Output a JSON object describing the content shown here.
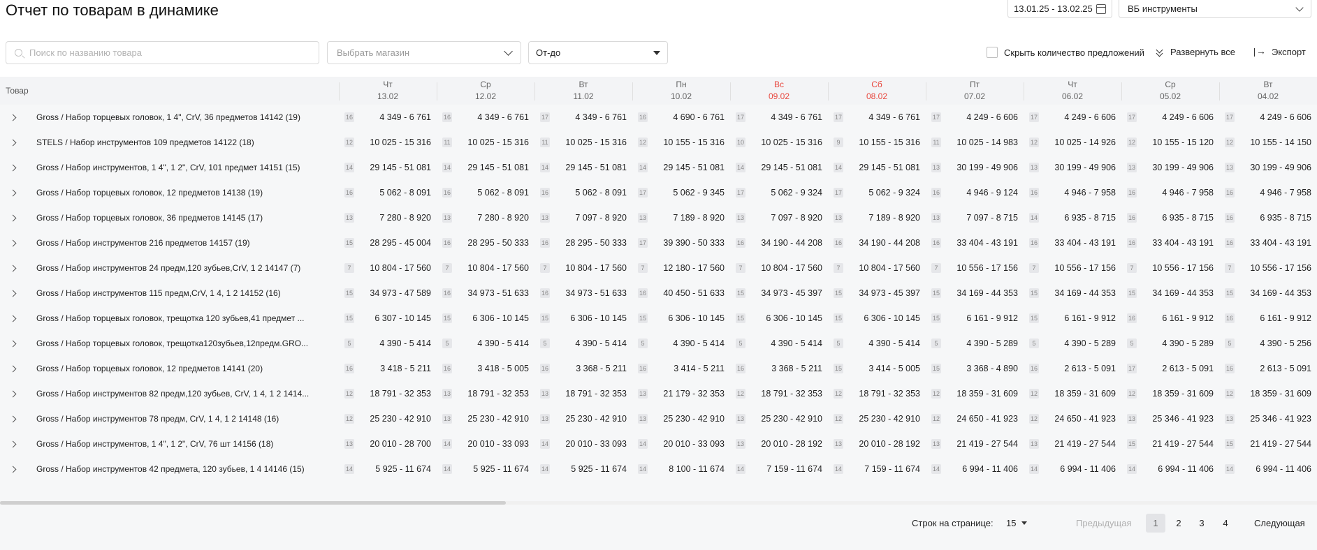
{
  "header": {
    "title": "Отчет по товарам в динамике",
    "date_range": "13.01.25 - 13.02.25",
    "shop": "ВБ инструменты"
  },
  "filters": {
    "search_placeholder": "Поиск по названию товара",
    "store_placeholder": "Выбрать магазин",
    "sort_value": "От-до",
    "hide_offers_label": "Скрыть количество предложений",
    "hide_offers_checked": false,
    "expand_all_label": "Развернуть все",
    "export_label": "Экспорт"
  },
  "table": {
    "product_header": "Товар",
    "days": [
      {
        "dow": "Чт",
        "date": "13.02",
        "weekend": false
      },
      {
        "dow": "Ср",
        "date": "12.02",
        "weekend": false
      },
      {
        "dow": "Вт",
        "date": "11.02",
        "weekend": false
      },
      {
        "dow": "Пн",
        "date": "10.02",
        "weekend": false
      },
      {
        "dow": "Вс",
        "date": "09.02",
        "weekend": true
      },
      {
        "dow": "Сб",
        "date": "08.02",
        "weekend": true
      },
      {
        "dow": "Пт",
        "date": "07.02",
        "weekend": false
      },
      {
        "dow": "Чт",
        "date": "06.02",
        "weekend": false
      },
      {
        "dow": "Ср",
        "date": "05.02",
        "weekend": false
      },
      {
        "dow": "Вт",
        "date": "04.02",
        "weekend": false
      }
    ],
    "rows": [
      {
        "name": "Gross / Набор торцевых головок, 1 4\", CrV, 36 предметов 14142 (19)",
        "cells": [
          [
            "16",
            "4 349 - 6 761"
          ],
          [
            "16",
            "4 349 - 6 761"
          ],
          [
            "17",
            "4 349 - 6 761"
          ],
          [
            "16",
            "4 690 - 6 761"
          ],
          [
            "17",
            "4 349 - 6 761"
          ],
          [
            "17",
            "4 349 - 6 761"
          ],
          [
            "17",
            "4 249 - 6 606"
          ],
          [
            "17",
            "4 249 - 6 606"
          ],
          [
            "17",
            "4 249 - 6 606"
          ],
          [
            "17",
            "4 249 - 6 606"
          ]
        ]
      },
      {
        "name": "STELS / Набор инструментов 109 предметов 14122 (18)",
        "cells": [
          [
            "12",
            "10 025 - 15 316"
          ],
          [
            "11",
            "10 025 - 15 316"
          ],
          [
            "11",
            "10 025 - 15 316"
          ],
          [
            "12",
            "10 155 - 15 316"
          ],
          [
            "10",
            "10 025 - 15 316"
          ],
          [
            "9",
            "10 155 - 15 316"
          ],
          [
            "11",
            "10 025 - 14 983"
          ],
          [
            "12",
            "10 025 - 14 926"
          ],
          [
            "12",
            "10 155 - 15 120"
          ],
          [
            "12",
            "10 155 - 14 150"
          ]
        ]
      },
      {
        "name": "Gross / Набор инструментов, 1 4\", 1 2\", CrV, 101 предмет 14151 (15)",
        "cells": [
          [
            "14",
            "29 145 - 51 081"
          ],
          [
            "14",
            "29 145 - 51 081"
          ],
          [
            "14",
            "29 145 - 51 081"
          ],
          [
            "14",
            "29 145 - 51 081"
          ],
          [
            "14",
            "29 145 - 51 081"
          ],
          [
            "14",
            "29 145 - 51 081"
          ],
          [
            "13",
            "30 199 - 49 906"
          ],
          [
            "13",
            "30 199 - 49 906"
          ],
          [
            "13",
            "30 199 - 49 906"
          ],
          [
            "13",
            "30 199 - 49 906"
          ]
        ]
      },
      {
        "name": "Gross / Набор торцевых головок, 12 предметов 14138 (19)",
        "cells": [
          [
            "16",
            "5 062 - 8 091"
          ],
          [
            "16",
            "5 062 - 8 091"
          ],
          [
            "16",
            "5 062 - 8 091"
          ],
          [
            "17",
            "5 062 - 9 345"
          ],
          [
            "17",
            "5 062 - 9 324"
          ],
          [
            "17",
            "5 062 - 9 324"
          ],
          [
            "16",
            "4 946 - 9 124"
          ],
          [
            "16",
            "4 946 - 7 958"
          ],
          [
            "16",
            "4 946 - 7 958"
          ],
          [
            "16",
            "4 946 - 7 958"
          ]
        ]
      },
      {
        "name": "Gross / Набор торцевых головок, 36 предметов 14145 (17)",
        "cells": [
          [
            "13",
            "7 280 - 8 920"
          ],
          [
            "13",
            "7 280 - 8 920"
          ],
          [
            "13",
            "7 097 - 8 920"
          ],
          [
            "13",
            "7 189 - 8 920"
          ],
          [
            "13",
            "7 097 - 8 920"
          ],
          [
            "13",
            "7 189 - 8 920"
          ],
          [
            "13",
            "7 097 - 8 715"
          ],
          [
            "14",
            "6 935 - 8 715"
          ],
          [
            "16",
            "6 935 - 8 715"
          ],
          [
            "16",
            "6 935 - 8 715"
          ]
        ]
      },
      {
        "name": "Gross / Набор инструментов 216 предметов 14157 (19)",
        "cells": [
          [
            "15",
            "28 295 - 45 004"
          ],
          [
            "16",
            "28 295 - 50 333"
          ],
          [
            "16",
            "28 295 - 50 333"
          ],
          [
            "17",
            "39 390 - 50 333"
          ],
          [
            "16",
            "34 190 - 44 208"
          ],
          [
            "16",
            "34 190 - 44 208"
          ],
          [
            "16",
            "33 404 - 43 191"
          ],
          [
            "16",
            "33 404 - 43 191"
          ],
          [
            "16",
            "33 404 - 43 191"
          ],
          [
            "16",
            "33 404 - 43 191"
          ]
        ]
      },
      {
        "name": "Gross / Набор инструментов 24 предм,120 зубьев,CrV, 1 2 14147 (7)",
        "cells": [
          [
            "7",
            "10 804 - 17 560"
          ],
          [
            "7",
            "10 804 - 17 560"
          ],
          [
            "7",
            "10 804 - 17 560"
          ],
          [
            "7",
            "12 180 - 17 560"
          ],
          [
            "7",
            "10 804 - 17 560"
          ],
          [
            "7",
            "10 804 - 17 560"
          ],
          [
            "7",
            "10 556 - 17 156"
          ],
          [
            "7",
            "10 556 - 17 156"
          ],
          [
            "7",
            "10 556 - 17 156"
          ],
          [
            "7",
            "10 556 - 17 156"
          ]
        ]
      },
      {
        "name": "Gross / Набор инструментов 115 предм,CrV, 1 4, 1 2 14152 (16)",
        "cells": [
          [
            "15",
            "34 973 - 47 589"
          ],
          [
            "16",
            "34 973 - 51 633"
          ],
          [
            "16",
            "34 973 - 51 633"
          ],
          [
            "16",
            "40 450 - 51 633"
          ],
          [
            "15",
            "34 973 - 45 397"
          ],
          [
            "15",
            "34 973 - 45 397"
          ],
          [
            "15",
            "34 169 - 44 353"
          ],
          [
            "15",
            "34 169 - 44 353"
          ],
          [
            "15",
            "34 169 - 44 353"
          ],
          [
            "15",
            "34 169 - 44 353"
          ]
        ]
      },
      {
        "name": "Gross / Набор торцевых головок, трещотка 120 зубьев,41 предмет ...",
        "cells": [
          [
            "15",
            "6 307 - 10 145"
          ],
          [
            "15",
            "6 306 - 10 145"
          ],
          [
            "15",
            "6 306 - 10 145"
          ],
          [
            "15",
            "6 306 - 10 145"
          ],
          [
            "15",
            "6 306 - 10 145"
          ],
          [
            "15",
            "6 306 - 10 145"
          ],
          [
            "15",
            "6 161 - 9 912"
          ],
          [
            "15",
            "6 161 - 9 912"
          ],
          [
            "16",
            "6 161 - 9 912"
          ],
          [
            "16",
            "6 161 - 9 912"
          ]
        ]
      },
      {
        "name": "Gross / Набор торцевых головок, трещотка120зубьев,12предм.GRO...",
        "cells": [
          [
            "5",
            "4 390 - 5 414"
          ],
          [
            "5",
            "4 390 - 5 414"
          ],
          [
            "5",
            "4 390 - 5 414"
          ],
          [
            "5",
            "4 390 - 5 414"
          ],
          [
            "5",
            "4 390 - 5 414"
          ],
          [
            "5",
            "4 390 - 5 414"
          ],
          [
            "5",
            "4 390 - 5 289"
          ],
          [
            "5",
            "4 390 - 5 289"
          ],
          [
            "5",
            "4 390 - 5 289"
          ],
          [
            "5",
            "4 390 - 5 256"
          ]
        ]
      },
      {
        "name": "Gross / Набор торцевых головок, 12 предметов 14141 (20)",
        "cells": [
          [
            "16",
            "3 418 - 5 211"
          ],
          [
            "16",
            "3 418 - 5 005"
          ],
          [
            "16",
            "3 368 - 5 211"
          ],
          [
            "16",
            "3 414 - 5 211"
          ],
          [
            "16",
            "3 368 - 5 211"
          ],
          [
            "15",
            "3 414 - 5 005"
          ],
          [
            "15",
            "3 368 - 4 890"
          ],
          [
            "16",
            "2 613 - 5 091"
          ],
          [
            "17",
            "2 613 - 5 091"
          ],
          [
            "16",
            "2 613 - 5 091"
          ]
        ]
      },
      {
        "name": "Gross / Набор инструментов 82 предм,120 зубьев, CrV, 1 4, 1 2 1414...",
        "cells": [
          [
            "12",
            "18 791 - 32 353"
          ],
          [
            "13",
            "18 791 - 32 353"
          ],
          [
            "13",
            "18 791 - 32 353"
          ],
          [
            "13",
            "21 179 - 32 353"
          ],
          [
            "12",
            "18 791 - 32 353"
          ],
          [
            "12",
            "18 791 - 32 353"
          ],
          [
            "12",
            "18 359 - 31 609"
          ],
          [
            "12",
            "18 359 - 31 609"
          ],
          [
            "12",
            "18 359 - 31 609"
          ],
          [
            "12",
            "18 359 - 31 609"
          ]
        ]
      },
      {
        "name": "Gross / Набор инструментов 78 предм, CrV, 1 4, 1 2 14148 (16)",
        "cells": [
          [
            "12",
            "25 230 - 42 910"
          ],
          [
            "13",
            "25 230 - 42 910"
          ],
          [
            "13",
            "25 230 - 42 910"
          ],
          [
            "13",
            "25 230 - 42 910"
          ],
          [
            "13",
            "25 230 - 42 910"
          ],
          [
            "12",
            "25 230 - 42 910"
          ],
          [
            "12",
            "24 650 - 41 923"
          ],
          [
            "12",
            "24 650 - 41 923"
          ],
          [
            "13",
            "25 346 - 41 923"
          ],
          [
            "13",
            "25 346 - 41 923"
          ]
        ]
      },
      {
        "name": "Gross / Набор инструментов, 1 4\", 1 2\", CrV, 76 шт 14156 (18)",
        "cells": [
          [
            "13",
            "20 010 - 28 700"
          ],
          [
            "14",
            "20 010 - 33 093"
          ],
          [
            "14",
            "20 010 - 33 093"
          ],
          [
            "14",
            "20 010 - 33 093"
          ],
          [
            "13",
            "20 010 - 28 192"
          ],
          [
            "13",
            "20 010 - 28 192"
          ],
          [
            "13",
            "21 419 - 27 544"
          ],
          [
            "13",
            "21 419 - 27 544"
          ],
          [
            "15",
            "21 419 - 27 544"
          ],
          [
            "15",
            "21 419 - 27 544"
          ]
        ]
      },
      {
        "name": "Gross / Набор инструментов 42 предмета, 120 зубьев, 1 4 14146 (15)",
        "cells": [
          [
            "14",
            "5 925 - 11 674"
          ],
          [
            "14",
            "5 925 - 11 674"
          ],
          [
            "14",
            "5 925 - 11 674"
          ],
          [
            "14",
            "8 100 - 11 674"
          ],
          [
            "14",
            "7 159 - 11 674"
          ],
          [
            "14",
            "7 159 - 11 674"
          ],
          [
            "14",
            "6 994 - 11 406"
          ],
          [
            "14",
            "6 994 - 11 406"
          ],
          [
            "14",
            "6 994 - 11 406"
          ],
          [
            "14",
            "6 994 - 11 406"
          ]
        ]
      }
    ]
  },
  "pagination": {
    "rows_label": "Строк на странице:",
    "rows_value": "15",
    "prev_label": "Предыдущая",
    "next_label": "Следующая",
    "pages": [
      "1",
      "2",
      "3",
      "4"
    ],
    "active_page": "1"
  },
  "colors": {
    "weekend": "#e8483f",
    "header_bg": "#f3f4f6",
    "body_bg": "#f6f7f8",
    "badge_bg": "#e6e7ea"
  }
}
